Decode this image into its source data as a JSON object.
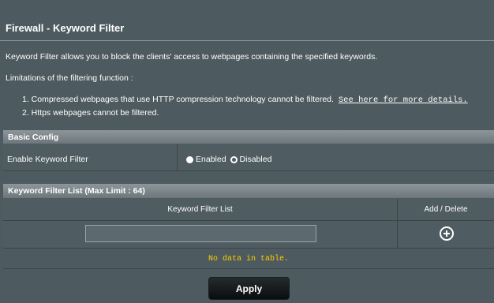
{
  "page": {
    "title": "Firewall - Keyword Filter",
    "description": "Keyword Filter allows you to block the clients' access to webpages containing the specified keywords.",
    "limitations_heading": "Limitations of the filtering function :",
    "limitations": [
      "1. Compressed webpages that use HTTP compression technology cannot be filtered.",
      "2. Https webpages cannot be filtered."
    ],
    "details_link": "See here for more details."
  },
  "basic_config": {
    "header": "Basic Config",
    "enable_label": "Enable Keyword Filter",
    "options": [
      {
        "label": "Enabled",
        "selected": true
      },
      {
        "label": "Disabled",
        "selected": false
      }
    ]
  },
  "keyword_list": {
    "header": "Keyword Filter List (Max Limit : 64)",
    "columns": [
      "Keyword Filter List",
      "Add / Delete"
    ],
    "input_value": "",
    "empty_message": "No data in table."
  },
  "actions": {
    "apply_label": "Apply"
  },
  "colors": {
    "background": "#4d5a5f",
    "section_header": "#7a8488",
    "empty_message": "#ffcc00",
    "button": "#111416"
  }
}
